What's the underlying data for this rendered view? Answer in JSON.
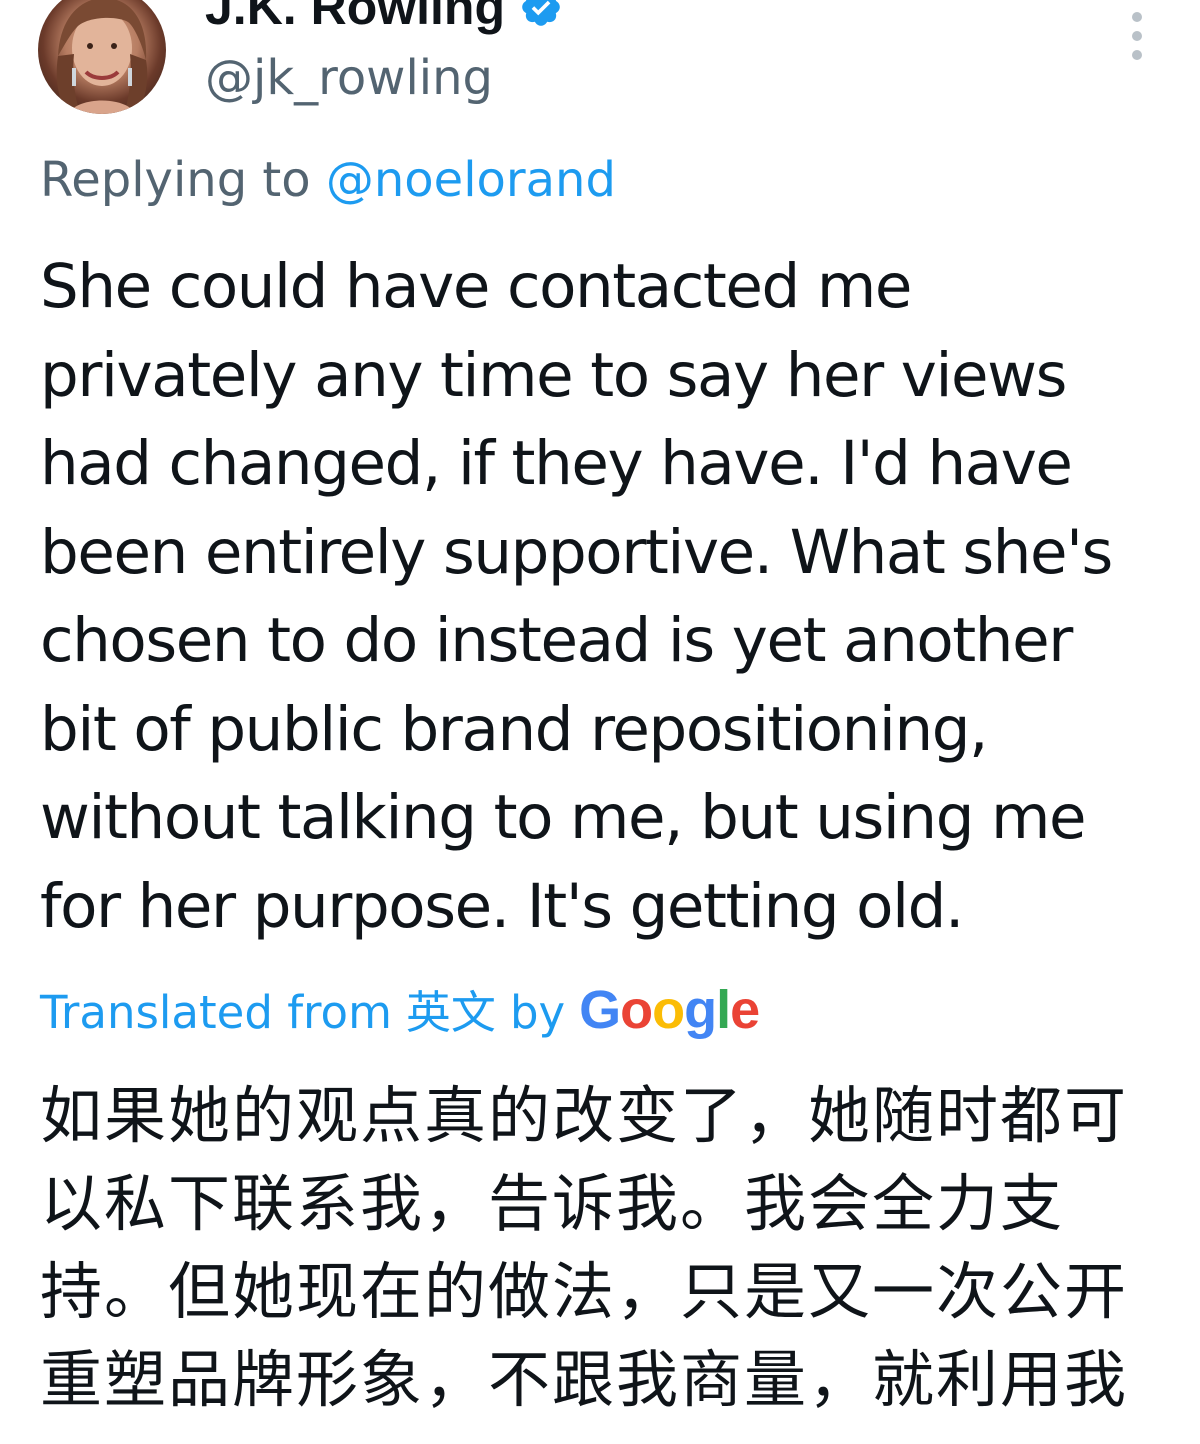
{
  "author": {
    "display_name": "J.K. Rowling",
    "handle": "@jk_rowling",
    "verified": true,
    "avatar_icon": "profile-photo-avatar",
    "verified_icon": "verified-badge-icon",
    "verified_color": "#1d9bf0"
  },
  "menu": {
    "icon": "more-vertical-icon"
  },
  "reply": {
    "prefix": "Replying to",
    "mention": "@noelorand",
    "mention_color": "#1d9bf0"
  },
  "tweet": {
    "lines": [
      "She could have contacted me",
      "privately any time to say her views",
      "had changed, if they have. I'd have",
      "been entirely supportive. What she's",
      "chosen to do instead is yet another",
      "bit of public brand repositioning,",
      "without talking to me, but using me",
      "for her purpose. It's getting old."
    ]
  },
  "translation": {
    "label_prefix": "Translated from",
    "source_language": "英文",
    "label_by": "by",
    "provider": "Google",
    "link_color": "#1d9bf0",
    "lines": [
      "如果她的观点真的改变了，她随时都可",
      "以私下联系我，告诉我。我会全力支",
      "持。但她现在的做法，只是又一次公开",
      "重塑品牌形象，不跟我商量，就利用我"
    ]
  }
}
